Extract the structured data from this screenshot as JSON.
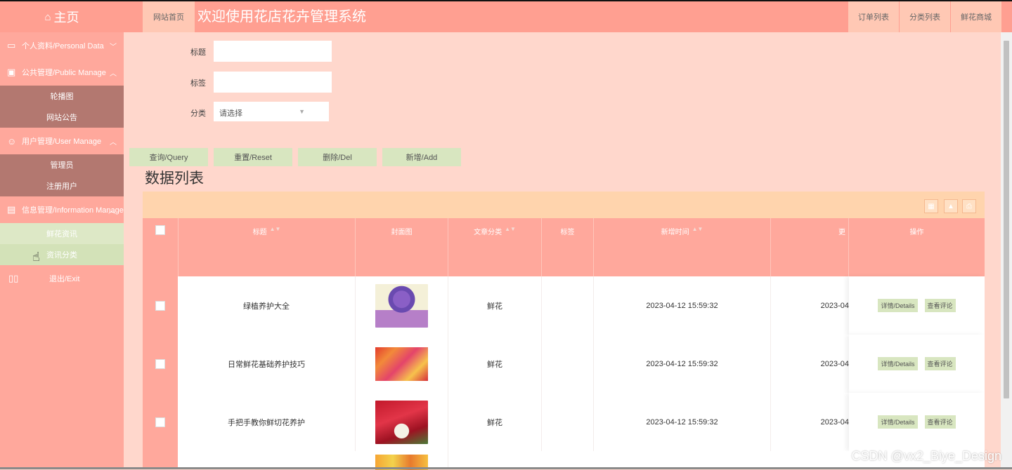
{
  "sidebar": {
    "brand": "主页",
    "groups": [
      {
        "label": "个人资料/Personal Data",
        "icon": "id-card-icon"
      },
      {
        "label": "公共管理/Public Manage",
        "icon": "monitor-icon",
        "items": [
          "轮播图",
          "网站公告"
        ]
      },
      {
        "label": "用户管理/User Manage",
        "icon": "user-icon",
        "items": [
          "管理员",
          "注册用户"
        ]
      },
      {
        "label": "信息管理/Information Manage",
        "icon": "document-icon",
        "items": [
          "鲜花资讯",
          "资讯分类"
        ]
      },
      {
        "label": "退出/Exit",
        "icon": "exit-icon"
      }
    ]
  },
  "header": {
    "home_tab": "网站首页",
    "title": "欢迎使用花店花卉管理系统",
    "nav": [
      "订单列表",
      "分类列表",
      "鲜花商城"
    ]
  },
  "form": {
    "title_label": "标题",
    "tag_label": "标签",
    "category_label": "分类",
    "category_placeholder": "请选择"
  },
  "buttons": {
    "query": "查询/Query",
    "reset": "重置/Reset",
    "delete": "删除/Del",
    "add": "新增/Add"
  },
  "list_title": "数据列表",
  "table": {
    "headers": [
      "标题",
      "封面图",
      "文章分类",
      "标签",
      "新增时间",
      "更",
      "操作"
    ],
    "rows": [
      {
        "title": "绿植养护大全",
        "category": "鲜花",
        "tag": "",
        "created": "2023-04-12 15:59:32",
        "updated": "2023-04"
      },
      {
        "title": "日常鲜花基础养护技巧",
        "category": "鲜花",
        "tag": "",
        "created": "2023-04-12 15:59:32",
        "updated": "2023-04"
      },
      {
        "title": "手把手教你鲜切花养护",
        "category": "鲜花",
        "tag": "",
        "created": "2023-04-12 15:59:32",
        "updated": "2023-04"
      }
    ],
    "row_actions": {
      "details": "详情/Details",
      "comments": "查看评论"
    }
  },
  "watermark": "CSDN @vx2_Biye_Design",
  "colors": {
    "accent": "#ff9f91",
    "sidebar": "#ffa89c",
    "background": "#ffd7cc",
    "button": "#d8e6c0"
  }
}
